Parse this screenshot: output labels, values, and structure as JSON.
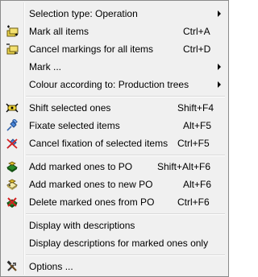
{
  "menu": {
    "items": [
      {
        "label": "Selection type: Operation",
        "shortcut": "",
        "submenu": true,
        "icon": ""
      },
      {
        "label": "Mark all items",
        "shortcut": "Ctrl+A",
        "submenu": false,
        "icon": "mark-all-icon"
      },
      {
        "label": "Cancel markings for all items",
        "shortcut": "Ctrl+D",
        "submenu": false,
        "icon": "cancel-markings-icon"
      },
      {
        "label": "Mark ...",
        "shortcut": "",
        "submenu": true,
        "icon": ""
      },
      {
        "label": "Colour according to: Production trees",
        "shortcut": "",
        "submenu": true,
        "icon": ""
      },
      {
        "label": "Shift selected ones",
        "shortcut": "Shift+F4",
        "submenu": false,
        "icon": "shift-icon"
      },
      {
        "label": "Fixate selected items",
        "shortcut": "Alt+F5",
        "submenu": false,
        "icon": "pin-icon"
      },
      {
        "label": "Cancel fixation of selected items",
        "shortcut": "Ctrl+F5",
        "submenu": false,
        "icon": "unpin-icon"
      },
      {
        "label": "Add marked ones to PO",
        "shortcut": "Shift+Alt+F6",
        "submenu": false,
        "icon": "add-to-po-icon"
      },
      {
        "label": "Add marked ones to new PO",
        "shortcut": "Alt+F6",
        "submenu": false,
        "icon": "add-to-new-po-icon"
      },
      {
        "label": "Delete marked ones from PO",
        "shortcut": "Ctrl+F6",
        "submenu": false,
        "icon": "delete-from-po-icon"
      },
      {
        "label": "Display with descriptions",
        "shortcut": "",
        "submenu": false,
        "icon": ""
      },
      {
        "label": "Display descriptions for marked ones only",
        "shortcut": "",
        "submenu": false,
        "icon": ""
      },
      {
        "label": "Options ...",
        "shortcut": "",
        "submenu": false,
        "icon": "tools-icon"
      }
    ]
  }
}
